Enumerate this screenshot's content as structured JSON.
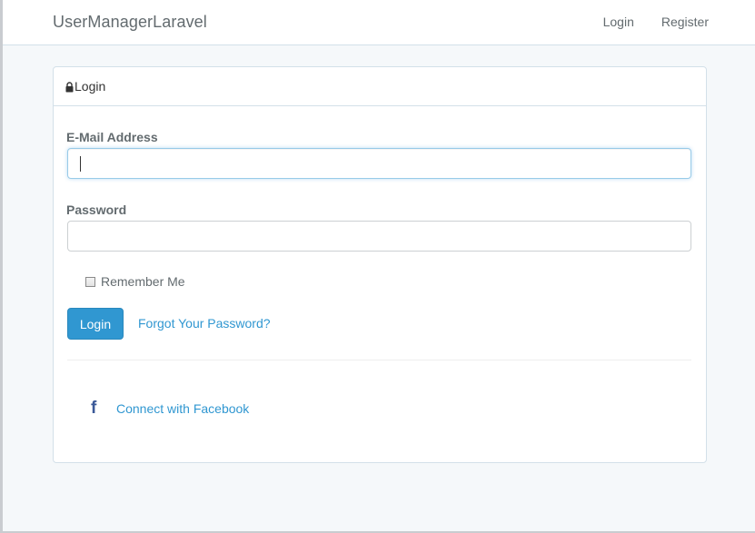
{
  "navbar": {
    "brand": "UserManagerLaravel",
    "links": [
      "Login",
      "Register"
    ]
  },
  "panel": {
    "heading": "Login",
    "heading_icon": "lock-icon"
  },
  "form": {
    "email_label": "E-Mail Address",
    "email_value": "",
    "password_label": "Password",
    "password_value": "",
    "remember_label": "Remember Me",
    "remember_checked": false,
    "submit_label": "Login",
    "forgot_label": "Forgot Your Password?"
  },
  "social": {
    "facebook_icon": "facebook-icon",
    "facebook_label": "Connect with Facebook"
  },
  "colors": {
    "accent": "#3097d1",
    "facebook": "#3b5998",
    "text": "#636b6f",
    "background": "#f5f8fa"
  }
}
